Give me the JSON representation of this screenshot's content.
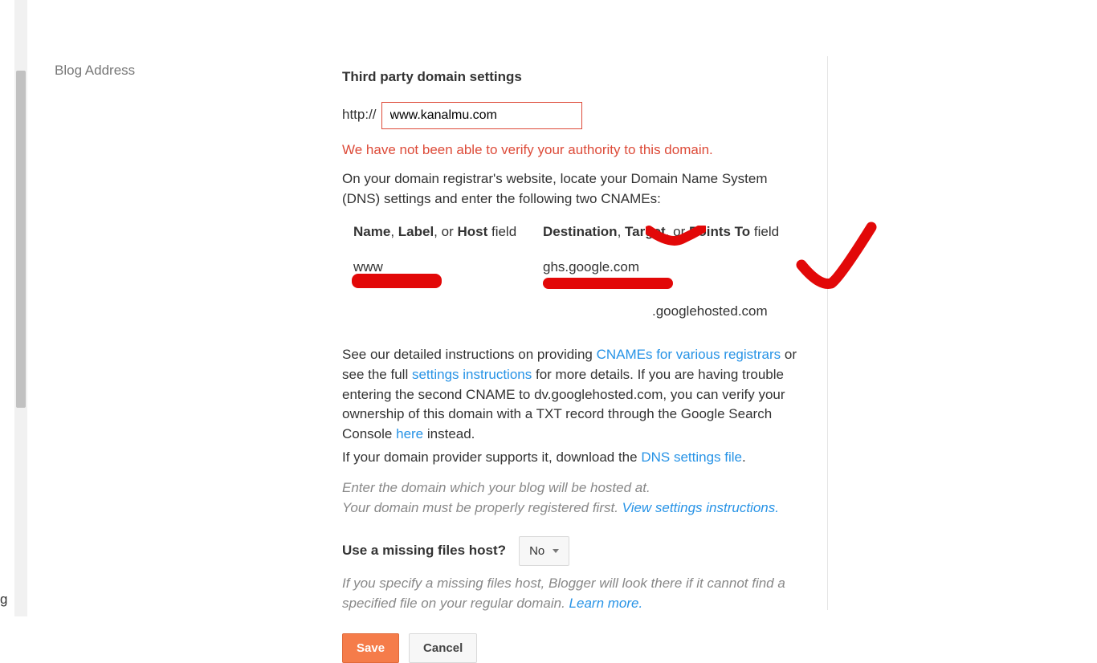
{
  "sidebar": {
    "section_label": "Blog Address"
  },
  "cut_off": {
    "letter": "g"
  },
  "settings": {
    "heading": "Third party domain settings",
    "url_prefix": "http://",
    "domain_value": "www.kanalmu.com",
    "error": "We have not been able to verify your authority to this domain.",
    "dns_intro_1": "On your domain registrar's website, locate your Domain Name System (DNS) settings and enter the following two CNAMEs:",
    "col_head_left_prefix": "Name",
    "col_head_left_mid": "Label",
    "col_head_left_or": ", or ",
    "col_head_left_suffix": "Host",
    "col_head_left_tail": " field",
    "col_head_right_prefix": "Destination",
    "col_head_right_mid": "Target",
    "col_head_right_or": ", or ",
    "col_head_right_suffix": "Points To",
    "col_head_right_tail": " field",
    "cname1_name": "www",
    "cname1_dest": "ghs.google.com",
    "cname2_name": "",
    "cname2_dest_suffix": ".googlehosted.com",
    "para1_a": "See our detailed instructions on providing ",
    "link_cnames": "CNAMEs for various registrars",
    "para1_b": " or see the full ",
    "link_settings": "settings instructions",
    "para1_c": " for more details. If you are having trouble entering the second CNAME to dv.googlehosted.com, you can verify your ownership of this domain with a TXT record through the Google Search Console ",
    "link_here": "here",
    "para1_d": " instead.",
    "para2_a": "If your domain provider supports it, download the ",
    "link_dnsfile": "DNS settings file",
    "para2_b": ".",
    "help1_a": "Enter the domain which your blog will be hosted at.",
    "help1_b": "Your domain must be properly registered first. ",
    "link_view_settings": "View settings instructions.",
    "missing_label": "Use a missing files host?",
    "missing_value": "No",
    "help2_a": "If you specify a missing files host, Blogger will look there if it cannot find a specified file on your regular domain. ",
    "link_learn": "Learn more.",
    "save_label": "Save",
    "cancel_label": "Cancel"
  }
}
